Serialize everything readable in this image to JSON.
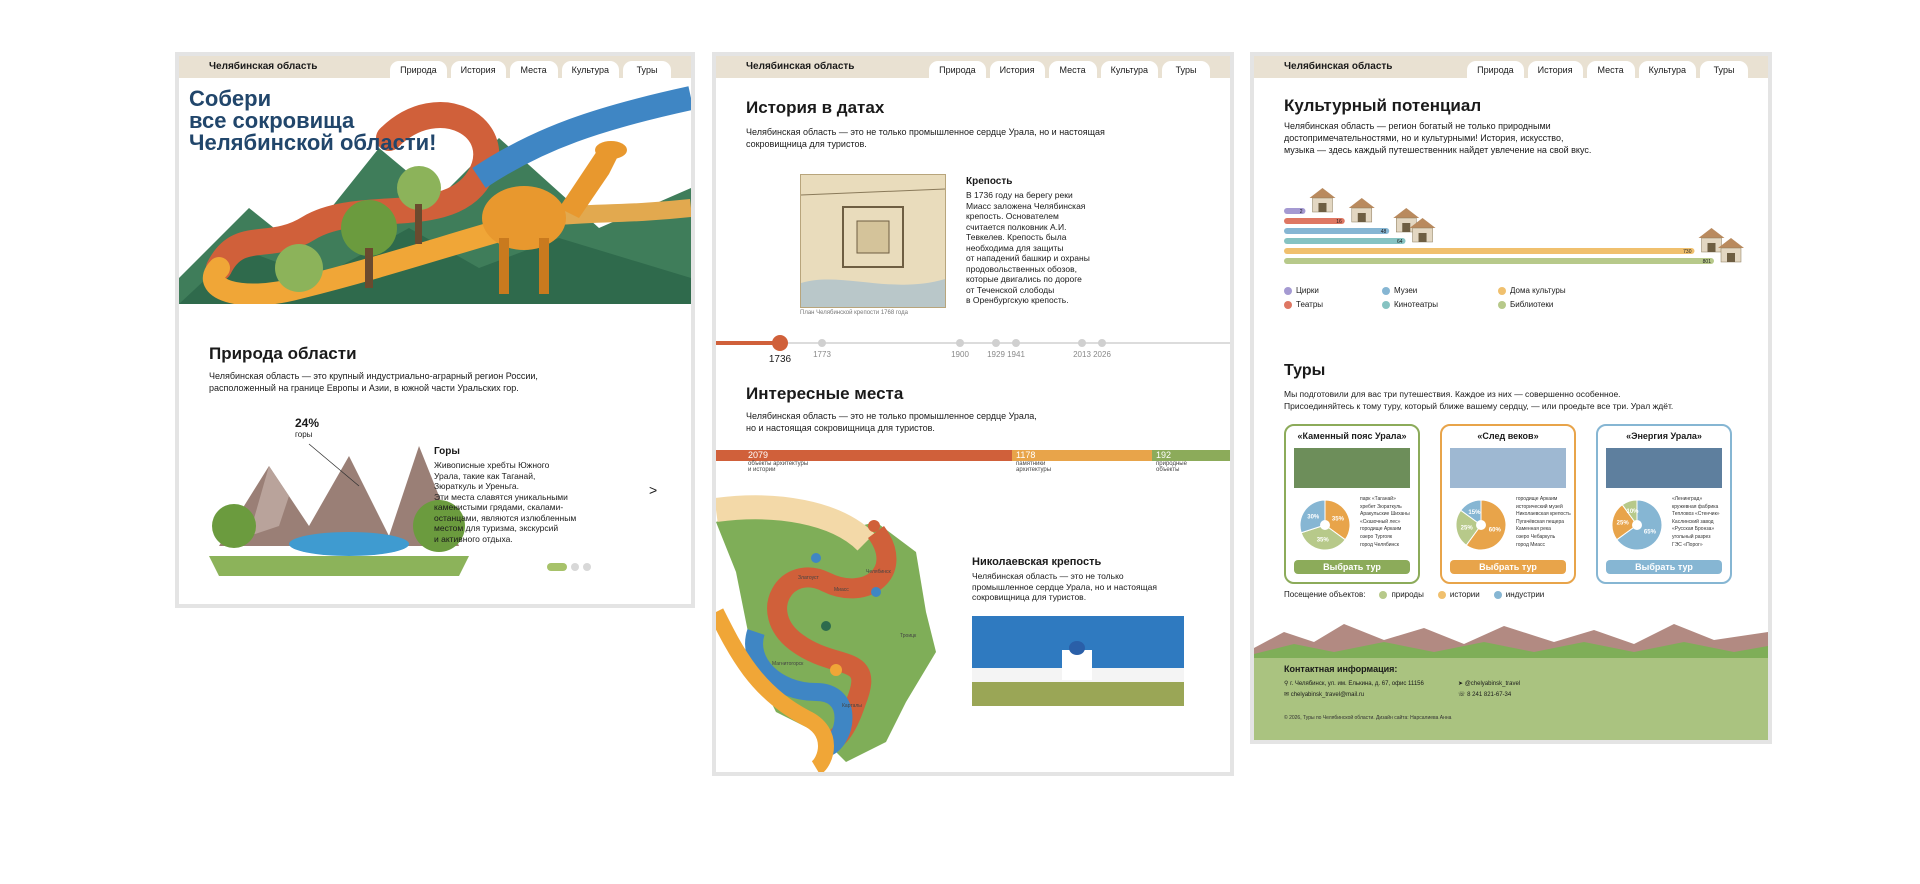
{
  "nav": {
    "brand": "Челябинская область",
    "tabs": [
      "Природа",
      "История",
      "Места",
      "Культура",
      "Туры"
    ]
  },
  "hero": {
    "title_line1": "Собери",
    "title_line2": "все сокровища",
    "title_line3": "Челябинской области!"
  },
  "nature": {
    "title": "Природа области",
    "text_line1": "Челябинская область — это крупный индустриально-аграрный регион России,",
    "text_line2": "расположенный на границе Европы и Азии, в южной части Уральских гор.",
    "percent": "24%",
    "percent_label": "горы",
    "card_title": "Горы",
    "card_lines": [
      "Живописные хребты Южного",
      "Урала, такие как Таганай,",
      "Зюраткуль и Уреньга.",
      "Эти места славятся уникальными",
      "каменистыми грядами, скалами-",
      "останцами, являются излюбленным",
      "местом для туризма, экскурсий",
      "и активного отдыха."
    ],
    "next_arrow": ">",
    "slider_index": 0,
    "slider_count": 3
  },
  "history": {
    "title": "История в датах",
    "text_line1": "Челябинская область — это не только промышленное сердце Урала, но и настоящая",
    "text_line2": "сокровищница для туристов.",
    "caption": "План Челябинской крепости 1768 года",
    "card_title": "Крепость",
    "card_lines": [
      "В 1736 году на берегу реки",
      "Миасс заложена Челябинская",
      "крепость. Основателем",
      "считается полковник А.И.",
      "Тевкелев. Крепость была",
      "необходима для защиты",
      "от нападений башкир и охраны",
      "продовольственных обозов,",
      "которые двигались по дороге",
      "от Теченской слободы",
      "в Оренбургскую крепость."
    ],
    "years": [
      "1736",
      "1773",
      "1900",
      "1929",
      "1941",
      "2013",
      "2026"
    ],
    "active_year": "1736"
  },
  "places": {
    "title": "Интересные места",
    "text_line1": "Челябинская область — это не только промышленное сердце Урала,",
    "text_line2": "но и настоящая сокровищница для туристов.",
    "stats": [
      {
        "value": "2079",
        "label_line1": "объекты архитектуры",
        "label_line2": "и истории",
        "color": "#d0603a"
      },
      {
        "value": "1178",
        "label_line1": "памятники",
        "label_line2": "архитектуры",
        "color": "#e8a44a"
      },
      {
        "value": "192",
        "label_line1": "природные",
        "label_line2": "объекты",
        "color": "#8cab5a"
      }
    ],
    "cities": [
      "Златоуст",
      "Миасс",
      "Челябинск",
      "Троицк",
      "Магнитогорск",
      "Карталы"
    ],
    "card_title": "Николаевская крепость",
    "card_lines": [
      "Челябинская область — это не только",
      "промышленное сердце Урала, но и настоящая",
      "сокровищница для туристов."
    ]
  },
  "culture": {
    "title": "Культурный потенциал",
    "text_line1": "Челябинская область — регион богатый не только природными",
    "text_line2": "достопримечательностями, но и культурными! История, искусство,",
    "text_line3": "музыка — здесь каждый путешественник найдет увлечение на свой вкус.",
    "bars": [
      {
        "name": "Цирки",
        "value": 2,
        "color": "#a59ad2"
      },
      {
        "name": "Театры",
        "value": 16,
        "color": "#de7763"
      },
      {
        "name": "Музеи",
        "value": 48,
        "color": "#86b6d3"
      },
      {
        "name": "Кинотеатры",
        "value": 64,
        "color": "#86c3c2"
      },
      {
        "name": "Дома культуры",
        "value": 730,
        "color": "#f0c06e"
      },
      {
        "name": "Библиотеки",
        "value": 801,
        "color": "#b7c98a"
      }
    ],
    "legend": [
      "Цирки",
      "Театры",
      "Музеи",
      "Кинотеатры",
      "Дома культуры",
      "Библиотеки"
    ]
  },
  "tours": {
    "title": "Туры",
    "text_line1": "Мы подготовили для вас три путешествия. Каждое из них — совершенно особенное.",
    "text_line2": "Присоединяйтесь к тому туру, который ближе вашему сердцу, — или проедьте все три. Урал ждёт.",
    "cards": [
      {
        "title": "«Каменный пояс Урала»",
        "border": "#8cab5a",
        "button": "Выбрать тур",
        "shares": [
          {
            "label": "35%",
            "color": "#e8a44a"
          },
          {
            "label": "35%",
            "color": "#b7c98a"
          },
          {
            "label": "30%",
            "color": "#86b6d3"
          }
        ],
        "items": [
          "парк «Таганай»",
          "хребет Зюраткуль",
          "Аракульские Шиханы",
          "«Сказочный лес»",
          "городище Аркаим",
          "озеро Тургояк",
          "город Челябинск"
        ]
      },
      {
        "title": "«След веков»",
        "border": "#e8a44a",
        "button": "Выбрать тур",
        "shares": [
          {
            "label": "60%",
            "color": "#e8a44a"
          },
          {
            "label": "25%",
            "color": "#b7c98a"
          },
          {
            "label": "15%",
            "color": "#86b6d3"
          }
        ],
        "items": [
          "городище Аркаим",
          "исторический музей",
          "Николаевская крепость",
          "Пугачёвская пещера",
          "Каменная река",
          "озеро Чебаркуль",
          "город Миасс"
        ]
      },
      {
        "title": "«Энергия Урала»",
        "border": "#86b6d3",
        "button": "Выбрать тур",
        "shares": [
          {
            "label": "65%",
            "color": "#86b6d3"
          },
          {
            "label": "25%",
            "color": "#e8a44a"
          },
          {
            "label": "10%",
            "color": "#b7c98a"
          }
        ],
        "items": [
          "«Ленинград»",
          "кружевная фабрика",
          "Тепловоз «Стенчик»",
          "Каслинский завод",
          "«Русская Бронза»",
          "угольный разрез",
          "ГЭС «Порог»"
        ]
      }
    ],
    "visit_label": "Посещение объектов:",
    "visit_legend": [
      {
        "name": "природы",
        "color": "#b7c98a"
      },
      {
        "name": "истории",
        "color": "#f0c06e"
      },
      {
        "name": "индустрии",
        "color": "#86b6d3"
      }
    ]
  },
  "contacts": {
    "title": "Контактная информация:",
    "address": "г. Челябинск, ул. им. Елькина, д. 67, офис 11156",
    "email": "chelyabinsk_travel@mail.ru",
    "telegram": "@chelyabinsk_travel",
    "phone": "8 241 821-67-34",
    "copyright": "© 2026, Туры по Челябинской области. Дизайн сайта: Нарсалиева Анна"
  }
}
